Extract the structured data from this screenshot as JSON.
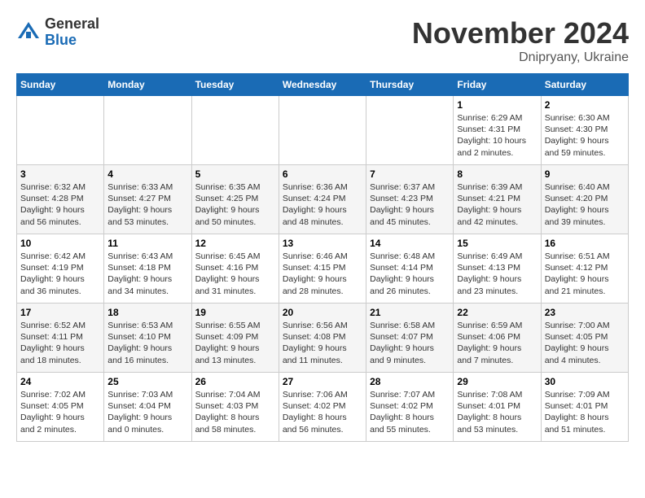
{
  "logo": {
    "general": "General",
    "blue": "Blue"
  },
  "title": "November 2024",
  "location": "Dnipryany, Ukraine",
  "weekdays": [
    "Sunday",
    "Monday",
    "Tuesday",
    "Wednesday",
    "Thursday",
    "Friday",
    "Saturday"
  ],
  "weeks": [
    [
      {
        "day": "",
        "info": ""
      },
      {
        "day": "",
        "info": ""
      },
      {
        "day": "",
        "info": ""
      },
      {
        "day": "",
        "info": ""
      },
      {
        "day": "",
        "info": ""
      },
      {
        "day": "1",
        "info": "Sunrise: 6:29 AM\nSunset: 4:31 PM\nDaylight: 10 hours\nand 2 minutes."
      },
      {
        "day": "2",
        "info": "Sunrise: 6:30 AM\nSunset: 4:30 PM\nDaylight: 9 hours\nand 59 minutes."
      }
    ],
    [
      {
        "day": "3",
        "info": "Sunrise: 6:32 AM\nSunset: 4:28 PM\nDaylight: 9 hours\nand 56 minutes."
      },
      {
        "day": "4",
        "info": "Sunrise: 6:33 AM\nSunset: 4:27 PM\nDaylight: 9 hours\nand 53 minutes."
      },
      {
        "day": "5",
        "info": "Sunrise: 6:35 AM\nSunset: 4:25 PM\nDaylight: 9 hours\nand 50 minutes."
      },
      {
        "day": "6",
        "info": "Sunrise: 6:36 AM\nSunset: 4:24 PM\nDaylight: 9 hours\nand 48 minutes."
      },
      {
        "day": "7",
        "info": "Sunrise: 6:37 AM\nSunset: 4:23 PM\nDaylight: 9 hours\nand 45 minutes."
      },
      {
        "day": "8",
        "info": "Sunrise: 6:39 AM\nSunset: 4:21 PM\nDaylight: 9 hours\nand 42 minutes."
      },
      {
        "day": "9",
        "info": "Sunrise: 6:40 AM\nSunset: 4:20 PM\nDaylight: 9 hours\nand 39 minutes."
      }
    ],
    [
      {
        "day": "10",
        "info": "Sunrise: 6:42 AM\nSunset: 4:19 PM\nDaylight: 9 hours\nand 36 minutes."
      },
      {
        "day": "11",
        "info": "Sunrise: 6:43 AM\nSunset: 4:18 PM\nDaylight: 9 hours\nand 34 minutes."
      },
      {
        "day": "12",
        "info": "Sunrise: 6:45 AM\nSunset: 4:16 PM\nDaylight: 9 hours\nand 31 minutes."
      },
      {
        "day": "13",
        "info": "Sunrise: 6:46 AM\nSunset: 4:15 PM\nDaylight: 9 hours\nand 28 minutes."
      },
      {
        "day": "14",
        "info": "Sunrise: 6:48 AM\nSunset: 4:14 PM\nDaylight: 9 hours\nand 26 minutes."
      },
      {
        "day": "15",
        "info": "Sunrise: 6:49 AM\nSunset: 4:13 PM\nDaylight: 9 hours\nand 23 minutes."
      },
      {
        "day": "16",
        "info": "Sunrise: 6:51 AM\nSunset: 4:12 PM\nDaylight: 9 hours\nand 21 minutes."
      }
    ],
    [
      {
        "day": "17",
        "info": "Sunrise: 6:52 AM\nSunset: 4:11 PM\nDaylight: 9 hours\nand 18 minutes."
      },
      {
        "day": "18",
        "info": "Sunrise: 6:53 AM\nSunset: 4:10 PM\nDaylight: 9 hours\nand 16 minutes."
      },
      {
        "day": "19",
        "info": "Sunrise: 6:55 AM\nSunset: 4:09 PM\nDaylight: 9 hours\nand 13 minutes."
      },
      {
        "day": "20",
        "info": "Sunrise: 6:56 AM\nSunset: 4:08 PM\nDaylight: 9 hours\nand 11 minutes."
      },
      {
        "day": "21",
        "info": "Sunrise: 6:58 AM\nSunset: 4:07 PM\nDaylight: 9 hours\nand 9 minutes."
      },
      {
        "day": "22",
        "info": "Sunrise: 6:59 AM\nSunset: 4:06 PM\nDaylight: 9 hours\nand 7 minutes."
      },
      {
        "day": "23",
        "info": "Sunrise: 7:00 AM\nSunset: 4:05 PM\nDaylight: 9 hours\nand 4 minutes."
      }
    ],
    [
      {
        "day": "24",
        "info": "Sunrise: 7:02 AM\nSunset: 4:05 PM\nDaylight: 9 hours\nand 2 minutes."
      },
      {
        "day": "25",
        "info": "Sunrise: 7:03 AM\nSunset: 4:04 PM\nDaylight: 9 hours\nand 0 minutes."
      },
      {
        "day": "26",
        "info": "Sunrise: 7:04 AM\nSunset: 4:03 PM\nDaylight: 8 hours\nand 58 minutes."
      },
      {
        "day": "27",
        "info": "Sunrise: 7:06 AM\nSunset: 4:02 PM\nDaylight: 8 hours\nand 56 minutes."
      },
      {
        "day": "28",
        "info": "Sunrise: 7:07 AM\nSunset: 4:02 PM\nDaylight: 8 hours\nand 55 minutes."
      },
      {
        "day": "29",
        "info": "Sunrise: 7:08 AM\nSunset: 4:01 PM\nDaylight: 8 hours\nand 53 minutes."
      },
      {
        "day": "30",
        "info": "Sunrise: 7:09 AM\nSunset: 4:01 PM\nDaylight: 8 hours\nand 51 minutes."
      }
    ]
  ]
}
